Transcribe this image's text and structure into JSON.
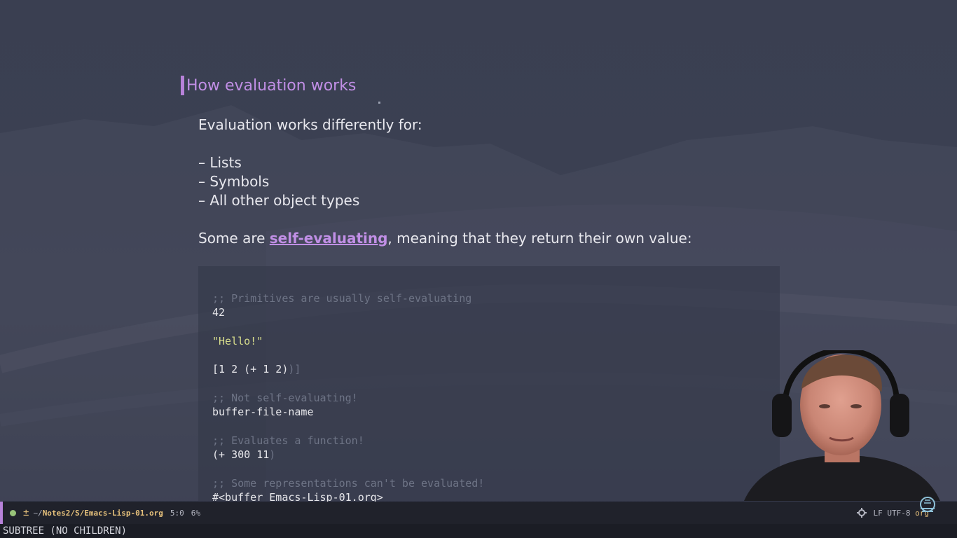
{
  "slide": {
    "heading": "How evaluation works",
    "intro": "Evaluation works differently for:",
    "list": [
      "– Lists",
      "– Symbols",
      "– All other object types"
    ],
    "self_eval_prefix": "Some are ",
    "self_eval_link": "self-evaluating",
    "self_eval_suffix": ", meaning that they return their own value:"
  },
  "code": {
    "line1": ";; Primitives are usually self-evaluating",
    "line2": "42",
    "line3": "\"Hello!\"",
    "line4_main": "[1 2 (+ 1 2)",
    "line4_dim": ")]",
    "line5": ";; Not self-evaluating!",
    "line6": "buffer-file-name",
    "line7": ";; Evaluates a function!",
    "line8_main": "(+ 300 11",
    "line8_dim": ")",
    "line9": ";; Some representations can't be evaluated!",
    "line10": "#<buffer Emacs-Lisp-01.org>"
  },
  "modeline": {
    "path_prefix": "~/",
    "path_bold": "Notes2/S/Emacs-Lisp-01.org",
    "position": "5:0",
    "percent": "6%",
    "encoding": "LF UTF-8",
    "mode_suffix": "org",
    "status_icon": "circle-icon",
    "modified_icon": "plus-minus-icon",
    "settings_icon": "gear-icon"
  },
  "minibuffer": {
    "message": "SUBTREE (NO CHILDREN)"
  },
  "colors": {
    "accent": "#b782d9",
    "link": "#c18fe6",
    "string": "#d7dd8c",
    "comment": "#6e7486"
  }
}
